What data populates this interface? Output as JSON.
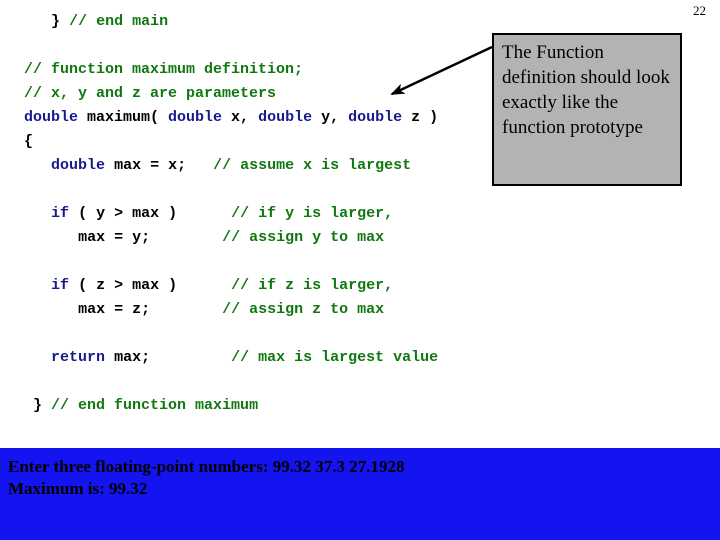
{
  "slide": {
    "page_number": "22",
    "background_color": "#ffffff"
  },
  "colors": {
    "keyword": "#1a1a8c",
    "comment": "#117711",
    "plain": "#000000",
    "callout_bg": "#b3b3b3",
    "callout_border": "#000000",
    "console_bg": "#1414f0",
    "console_text": "#000000"
  },
  "code": {
    "language": "C++",
    "lines": [
      {
        "indent": 3,
        "tokens": [
          {
            "t": "} ",
            "c": "pln"
          },
          {
            "t": "// end main",
            "c": "cmt"
          }
        ]
      },
      {
        "indent": 0,
        "tokens": []
      },
      {
        "indent": 0,
        "tokens": [
          {
            "t": "// function maximum definition;",
            "c": "cmt"
          }
        ]
      },
      {
        "indent": 0,
        "tokens": [
          {
            "t": "// x, y and z are parameters",
            "c": "cmt"
          }
        ]
      },
      {
        "indent": 0,
        "tokens": [
          {
            "t": "double",
            "c": "kw"
          },
          {
            "t": " maximum( ",
            "c": "pln"
          },
          {
            "t": "double",
            "c": "kw"
          },
          {
            "t": " x, ",
            "c": "pln"
          },
          {
            "t": "double",
            "c": "kw"
          },
          {
            "t": " y, ",
            "c": "pln"
          },
          {
            "t": "double",
            "c": "kw"
          },
          {
            "t": " z )",
            "c": "pln"
          }
        ]
      },
      {
        "indent": 0,
        "tokens": [
          {
            "t": "{",
            "c": "pln"
          }
        ]
      },
      {
        "indent": 3,
        "tokens": [
          {
            "t": "double",
            "c": "kw"
          },
          {
            "t": " max = x;   ",
            "c": "pln"
          },
          {
            "t": "// assume x is largest",
            "c": "cmt"
          }
        ]
      },
      {
        "indent": 0,
        "tokens": []
      },
      {
        "indent": 3,
        "tokens": [
          {
            "t": "if",
            "c": "kw"
          },
          {
            "t": " ( y > max )      ",
            "c": "pln"
          },
          {
            "t": "// if y is larger,",
            "c": "cmt"
          }
        ]
      },
      {
        "indent": 6,
        "tokens": [
          {
            "t": "max = y;        ",
            "c": "pln"
          },
          {
            "t": "// assign y to max",
            "c": "cmt"
          }
        ]
      },
      {
        "indent": 0,
        "tokens": []
      },
      {
        "indent": 3,
        "tokens": [
          {
            "t": "if",
            "c": "kw"
          },
          {
            "t": " ( z > max )      ",
            "c": "pln"
          },
          {
            "t": "// if z is larger,",
            "c": "cmt"
          }
        ]
      },
      {
        "indent": 6,
        "tokens": [
          {
            "t": "max = z;        ",
            "c": "pln"
          },
          {
            "t": "// assign z to max",
            "c": "cmt"
          }
        ]
      },
      {
        "indent": 0,
        "tokens": []
      },
      {
        "indent": 3,
        "tokens": [
          {
            "t": "return",
            "c": "kw"
          },
          {
            "t": " max;         ",
            "c": "pln"
          },
          {
            "t": "// max is largest value",
            "c": "cmt"
          }
        ]
      },
      {
        "indent": 0,
        "tokens": []
      },
      {
        "indent": 1,
        "tokens": [
          {
            "t": "} ",
            "c": "pln"
          },
          {
            "t": "// end function maximum",
            "c": "cmt"
          }
        ]
      }
    ]
  },
  "callout": {
    "text": "The Function definition should look exactly like the function prototype"
  },
  "console": {
    "lines": [
      "Enter three floating-point numbers: 99.32 37.3 27.1928",
      "Maximum is: 99.32"
    ]
  }
}
